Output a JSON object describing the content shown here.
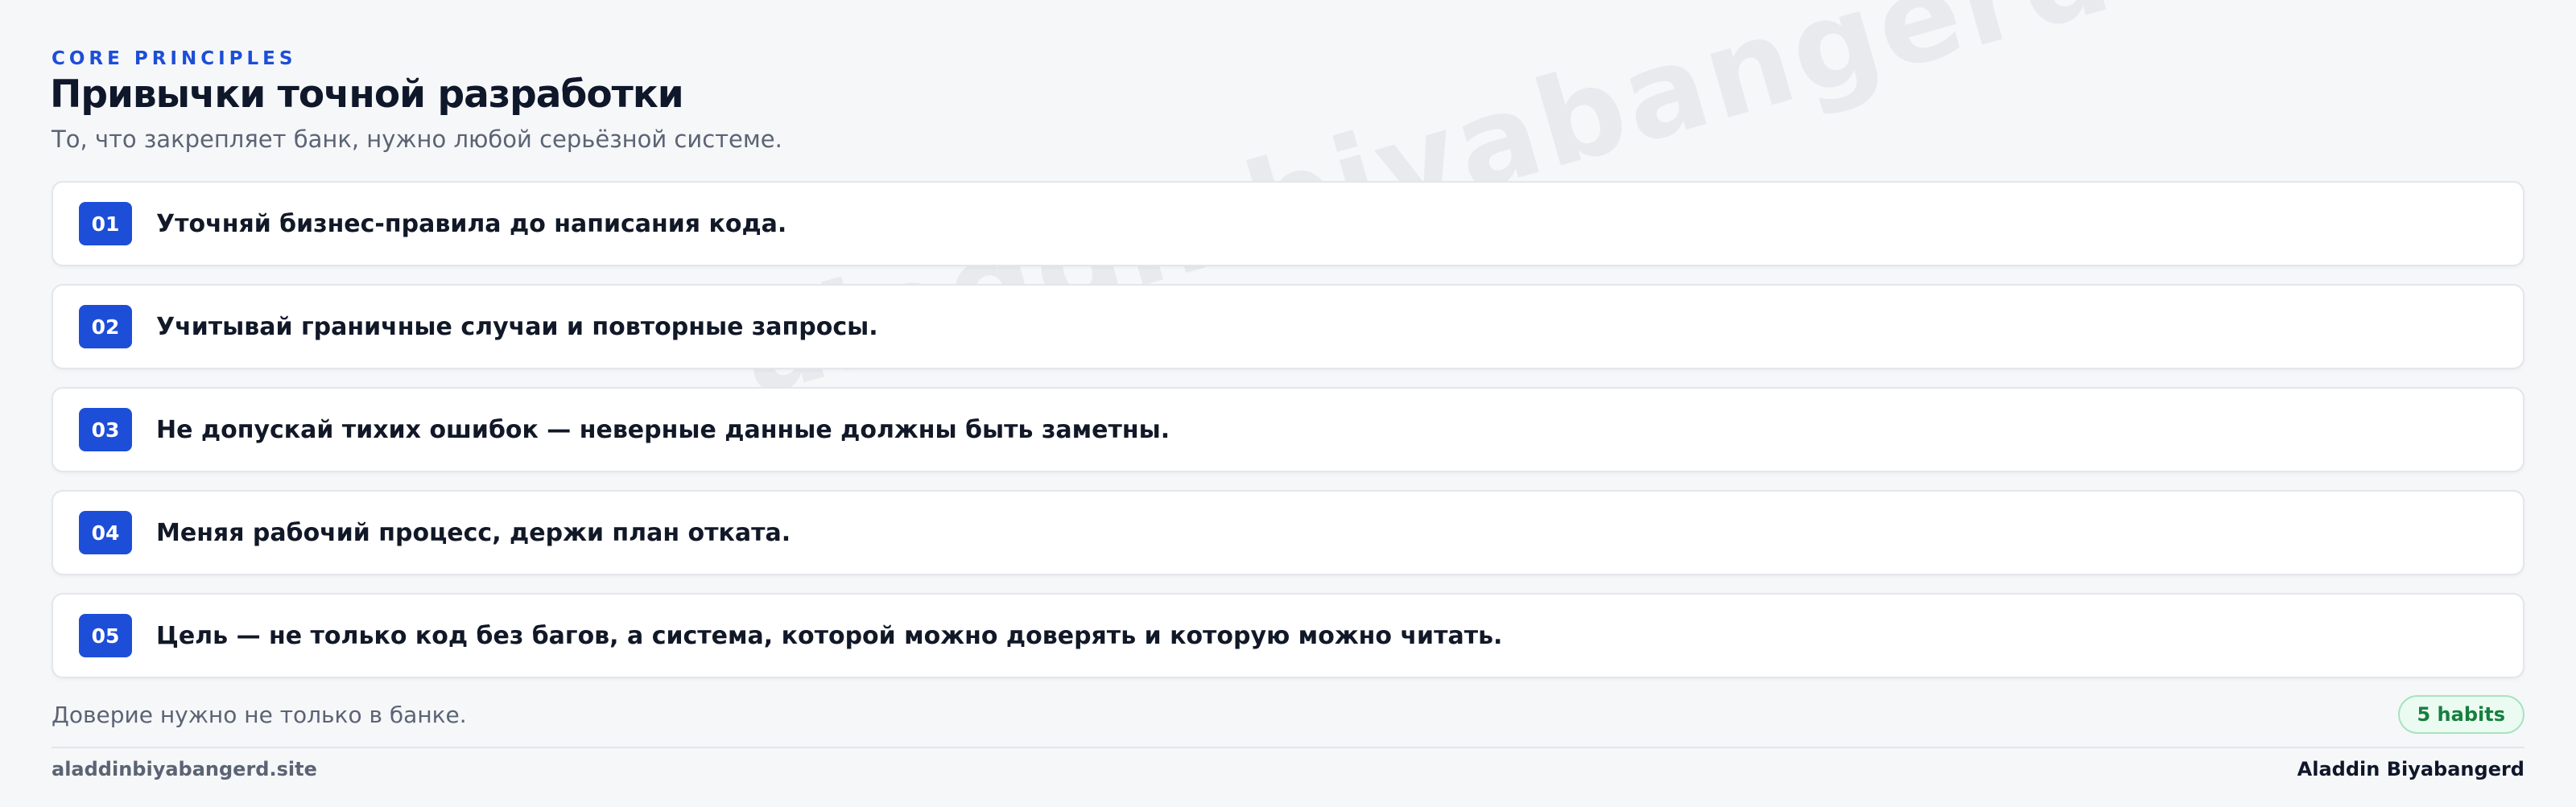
{
  "watermark": "aladdinbiyabangerd",
  "header": {
    "eyebrow": "CORE PRINCIPLES",
    "title": "Привычки точной разработки",
    "subtitle": "То, что закрепляет банк, нужно любой серьёзной системе."
  },
  "habits": [
    {
      "num": "01",
      "text": "Уточняй бизнес-правила до написания кода."
    },
    {
      "num": "02",
      "text": "Учитывай граничные случаи и повторные запросы."
    },
    {
      "num": "03",
      "text": "Не допускай тихих ошибок — неверные данные должны быть заметны."
    },
    {
      "num": "04",
      "text": "Меняя рабочий процесс, держи план отката."
    },
    {
      "num": "05",
      "text": "Цель — не только код без багов, а система, которой можно доверять и которую можно читать."
    }
  ],
  "footer": {
    "note": "Доверие нужно не только в банке.",
    "badge": "5 habits",
    "site": "aladdinbiyabangerd.site",
    "author": "Aladdin Biyabangerd"
  },
  "colors": {
    "accent": "#1d4ed8",
    "badge_text": "#15803d",
    "background": "#f6f7f9"
  }
}
